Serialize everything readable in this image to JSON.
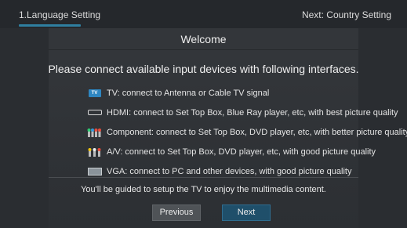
{
  "header": {
    "current_step": "1.Language Setting",
    "next_step": "Next: Country Setting"
  },
  "title": "Welcome",
  "instruction": "Please connect available input devices with following interfaces.",
  "interfaces": [
    {
      "icon": "tv-icon",
      "icon_text": "TV",
      "text": "TV: connect to Antenna or Cable TV signal"
    },
    {
      "icon": "hdmi-icon",
      "text": "HDMI: connect to Set Top Box, Blue Ray player, etc, with best picture quality"
    },
    {
      "icon": "component-icon",
      "text": "Component: connect to Set Top Box, DVD player, etc, with better picture quality"
    },
    {
      "icon": "av-icon",
      "text": "A/V: connect to Set Top Box, DVD player, etc, with good picture quality"
    },
    {
      "icon": "vga-icon",
      "text": "VGA: connect to PC and other devices, with good picture quality"
    }
  ],
  "guide": "You'll be guided to setup the TV to enjoy the multimedia content.",
  "buttons": {
    "previous": "Previous",
    "next": "Next"
  },
  "colors": {
    "accent": "#2f7fa0",
    "next_button": "#1f4f6a"
  }
}
